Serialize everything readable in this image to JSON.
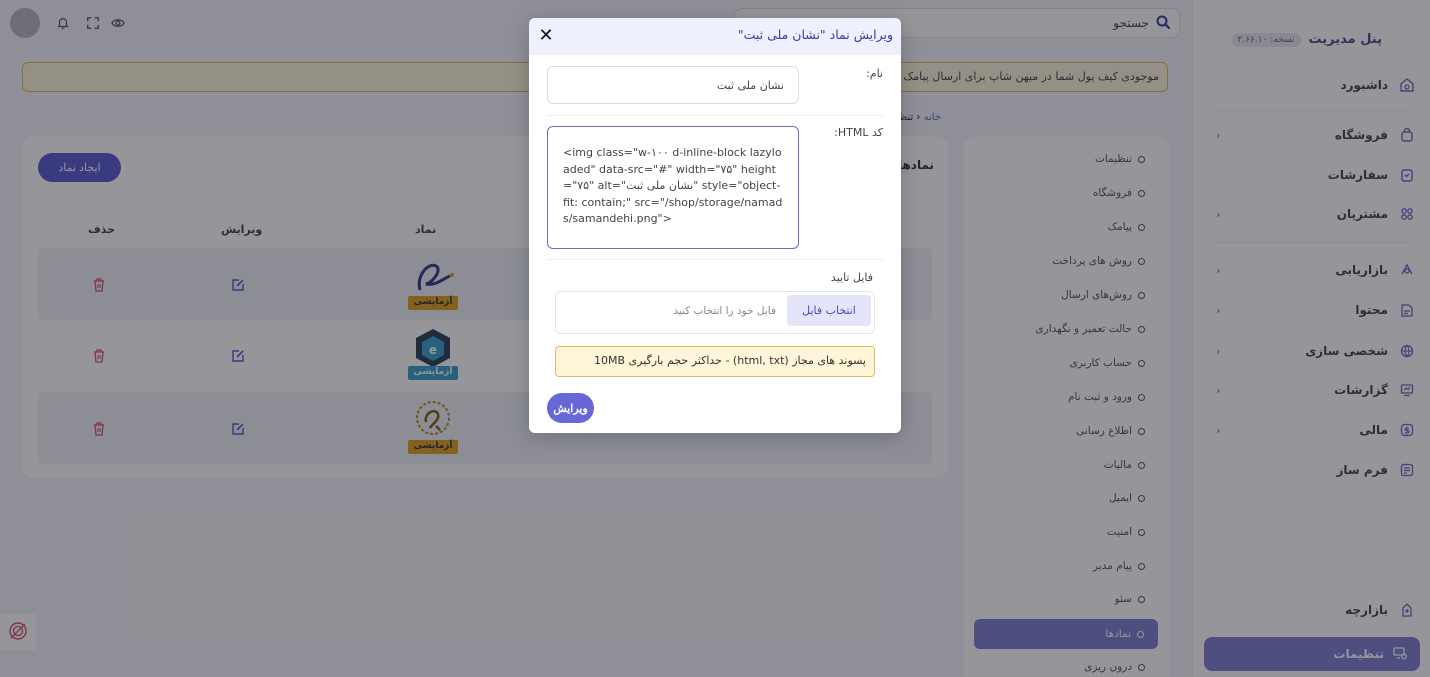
{
  "sidebar": {
    "brand_title": "پنل مدیریت",
    "version_badge": "نسخه: ۲.۶۶.۱۰",
    "items": [
      {
        "label": "داشبورد",
        "icon": "dashboard-icon"
      },
      {
        "label": "فروشگاه",
        "icon": "shop-bag-icon"
      },
      {
        "label": "سفارشات",
        "icon": "orders-clipboard-icon"
      },
      {
        "label": "مشتریان",
        "icon": "customers-icon"
      },
      {
        "label": "بازاریابی",
        "icon": "marketing-icon"
      },
      {
        "label": "محتوا",
        "icon": "content-icon"
      },
      {
        "label": "شخصی سازی",
        "icon": "globe-icon"
      },
      {
        "label": "گزارشات",
        "icon": "reports-icon"
      },
      {
        "label": "مالی",
        "icon": "finance-dollar-icon"
      },
      {
        "label": "فرم ساز",
        "icon": "form-builder-icon"
      },
      {
        "label": "بازارچه",
        "icon": "market-icon"
      }
    ],
    "active_label": "تنظیمات"
  },
  "topbar": {
    "search_label": "جستجو"
  },
  "alert_text": "موجودی کیف پول شما در میهن شاپ برای ارسال پیامک کافی نیست",
  "breadcrumb": {
    "home": "خانه",
    "current": "تنظیمات"
  },
  "settings_menu": {
    "items": [
      "تنظیمات",
      "فروشگاه",
      "پیامک",
      "روش های پرداخت",
      "روش‌های ارسال",
      "حالت تعمیر و نگهداری",
      "حساب کاربری",
      "ورود و ثبت نام",
      "اطلاع رسانی",
      "مالیات",
      "ایمیل",
      "امنیت",
      "پیام مدیر",
      "سئو"
    ],
    "active": "نمادها",
    "after_active": "درون ریزی"
  },
  "table": {
    "title": "نمادها",
    "create_button": "ایجاد نماد",
    "headers": {
      "symbol": "نماد",
      "edit": "ویرایش",
      "delete": "حذف"
    },
    "badge_label": "آزمایشی"
  },
  "modal": {
    "title": "ویرایش نماد \"نشان ملی ثبت\"",
    "name_label": "نام:",
    "name_value": "نشان ملی ثبت",
    "code_label": "کد HTML:",
    "code_value": "<img class=\"w-۱۰۰ d-inline-block lazyloaded\" data-src=\"#\" width=\"۷۵\" height=\"۷۵\" alt=\"نشان ملی ثبت\" style=\"object-fit: contain;\" src=\"/shop/storage/namads/samandehi.png\">",
    "file_label": "فایل تایید",
    "file_button": "انتخاب فایل",
    "file_placeholder": "فایل خود را انتخاب کنید",
    "hint": "پسوند های مجاز (html, txt) - حداکثر حجم بارگیری   10MB",
    "submit": "ویرایش"
  },
  "colors": {
    "accent": "#5a5acc",
    "danger": "#d9536a",
    "warning_bg": "#fff6d9"
  }
}
